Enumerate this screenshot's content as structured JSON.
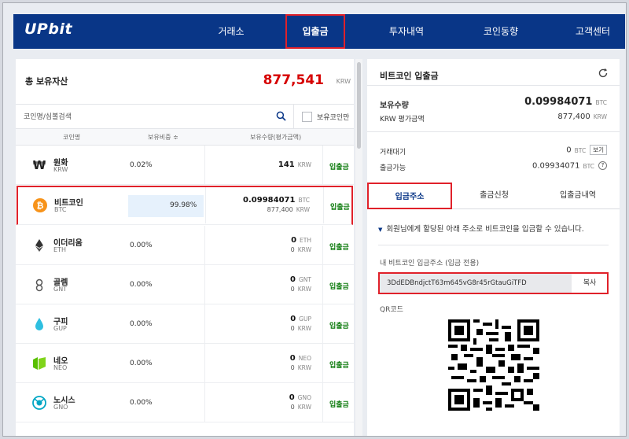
{
  "header": {
    "logo": "UPbit",
    "nav": [
      "거래소",
      "입출금",
      "투자내역",
      "코인동향",
      "고객센터"
    ]
  },
  "summary": {
    "label": "총 보유자산",
    "value": "877,541",
    "unit": "KRW"
  },
  "search": {
    "placeholder": "코인명/심볼검색",
    "owned_only_label": "보유코인만"
  },
  "table": {
    "headers": {
      "name": "코인명",
      "ratio": "보유비중 ≑",
      "amount": "보유수량(평가금액)"
    },
    "rows": [
      {
        "icon": "won-icon",
        "name": "원화",
        "symbol": "KRW",
        "ratio": "0.02%",
        "amount": "141",
        "amount_unit": "KRW",
        "krw": "",
        "krw_unit": "",
        "action": "입출금"
      },
      {
        "icon": "bitcoin-icon",
        "name": "비트코인",
        "symbol": "BTC",
        "ratio": "99.98%",
        "amount": "0.09984071",
        "amount_unit": "BTC",
        "krw": "877,400",
        "krw_unit": "KRW",
        "action": "입출금"
      },
      {
        "icon": "ethereum-icon",
        "name": "이더리움",
        "symbol": "ETH",
        "ratio": "0.00%",
        "amount": "0",
        "amount_unit": "ETH",
        "krw": "0",
        "krw_unit": "KRW",
        "action": "입출금"
      },
      {
        "icon": "golem-icon",
        "name": "골렘",
        "symbol": "GNT",
        "ratio": "0.00%",
        "amount": "0",
        "amount_unit": "GNT",
        "krw": "0",
        "krw_unit": "KRW",
        "action": "입출금"
      },
      {
        "icon": "gupi-icon",
        "name": "구피",
        "symbol": "GUP",
        "ratio": "0.00%",
        "amount": "0",
        "amount_unit": "GUP",
        "krw": "0",
        "krw_unit": "KRW",
        "action": "입출금"
      },
      {
        "icon": "neo-icon",
        "name": "네오",
        "symbol": "NEO",
        "ratio": "0.00%",
        "amount": "0",
        "amount_unit": "NEO",
        "krw": "0",
        "krw_unit": "KRW",
        "action": "입출금"
      },
      {
        "icon": "gnosis-icon",
        "name": "노시스",
        "symbol": "GNO",
        "ratio": "0.00%",
        "amount": "0",
        "amount_unit": "GNO",
        "krw": "0",
        "krw_unit": "KRW",
        "action": "입출금"
      }
    ]
  },
  "detail": {
    "title": "비트코인 입출금",
    "holdings_label": "보유수량",
    "holdings_value": "0.09984071",
    "holdings_unit": "BTC",
    "krw_label": "KRW 평가금액",
    "krw_value": "877,400",
    "krw_unit": "KRW",
    "pending_label": "거래대기",
    "pending_value": "0",
    "pending_unit": "BTC",
    "view_button": "보기",
    "withdrawable_label": "출금가능",
    "withdrawable_value": "0.09934071",
    "withdrawable_unit": "BTC",
    "help": "?",
    "tabs": [
      "입금주소",
      "출금신청",
      "입출금내역"
    ],
    "notice": "회원님에게 할당된 아래 주소로 비트코인을 입금할 수 있습니다.",
    "address_label": "내 비트코인 입금주소 (입금 전용)",
    "address": "3DdEDBndjctT63m645vG8r45rGtauGiTFD",
    "copy_button": "복사",
    "qr_label": "QR코드"
  },
  "colors": {
    "brand": "#093687",
    "total": "#d60000",
    "deposit": "#0b7a0b",
    "highlight": "#e0212a"
  }
}
